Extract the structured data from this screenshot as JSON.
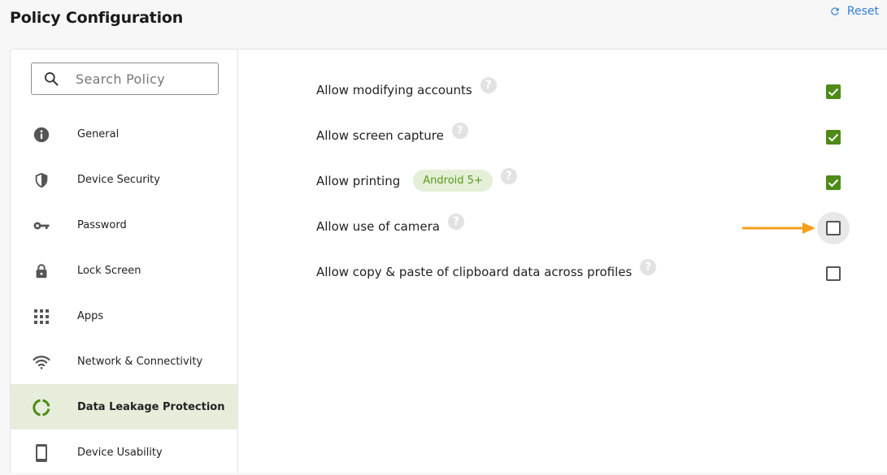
{
  "header": {
    "title": "Policy Configuration",
    "reset_label": "Reset"
  },
  "search": {
    "placeholder": "Search Policy",
    "value": ""
  },
  "sidebar": {
    "items": [
      {
        "label": "General",
        "icon": "info-icon"
      },
      {
        "label": "Device Security",
        "icon": "shield-icon"
      },
      {
        "label": "Password",
        "icon": "key-icon"
      },
      {
        "label": "Lock Screen",
        "icon": "lock-icon"
      },
      {
        "label": "Apps",
        "icon": "apps-grid-icon"
      },
      {
        "label": "Network & Connectivity",
        "icon": "wifi-icon"
      },
      {
        "label": "Data Leakage Protection",
        "icon": "donut-ring-icon",
        "active": true
      },
      {
        "label": "Device Usability",
        "icon": "phone-icon"
      }
    ]
  },
  "policies": [
    {
      "label": "Allow modifying accounts",
      "checked": true
    },
    {
      "label": "Allow screen capture",
      "checked": true
    },
    {
      "label": "Allow printing",
      "badge": "Android 5+",
      "checked": true
    },
    {
      "label": "Allow use of camera",
      "checked": false,
      "focused": true
    },
    {
      "label": "Allow copy & paste of clipboard data across profiles",
      "checked": false
    }
  ],
  "help_glyph": "?",
  "colors": {
    "accent_green": "#4e8a16",
    "active_bg": "#e6eedb",
    "badge_bg": "#e4efd7",
    "badge_text": "#5a9a1c",
    "reset_blue": "#2f7fd8",
    "arrow_orange": "#f5a01a"
  }
}
